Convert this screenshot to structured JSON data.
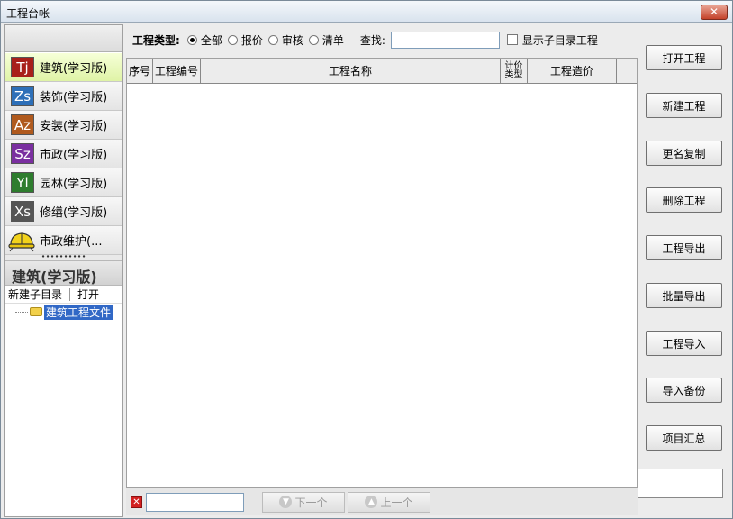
{
  "window": {
    "title": "工程台帐",
    "close_label": "✕"
  },
  "left": {
    "nav": [
      {
        "badge": "Tj",
        "label": "建筑(学习版)",
        "color": "#a8201a",
        "active": true
      },
      {
        "badge": "Zs",
        "label": "装饰(学习版)",
        "color": "#2d6fb8",
        "active": false
      },
      {
        "badge": "Az",
        "label": "安装(学习版)",
        "color": "#b05a1e",
        "active": false
      },
      {
        "badge": "Sz",
        "label": "市政(学习版)",
        "color": "#7a2fa0",
        "active": false
      },
      {
        "badge": "Yl",
        "label": "园林(学习版)",
        "color": "#2e7d2e",
        "active": false
      },
      {
        "badge": "Xs",
        "label": "修缮(学习版)",
        "color": "#555555",
        "active": false
      }
    ],
    "maintenance_label": "市政维护(...",
    "section_title": "建筑(学习版)",
    "tree_toolbar": {
      "new_dir": "新建子目录",
      "open": "打开"
    },
    "tree_item": "建筑工程文件"
  },
  "filter": {
    "label": "工程类型:",
    "options": [
      "全部",
      "报价",
      "审核",
      "清单"
    ],
    "selected": "全部",
    "search_label": "查找:",
    "search_value": "",
    "show_sub_label": "显示子目录工程"
  },
  "grid": {
    "columns": [
      "序号",
      "工程编号",
      "工程名称",
      "计价类型",
      "工程造价"
    ]
  },
  "bottom": {
    "next_label": "下一个",
    "prev_label": "上一个"
  },
  "actions": [
    "打开工程",
    "新建工程",
    "更名复制",
    "删除工程",
    "工程导出",
    "批量导出",
    "工程导入",
    "导入备份",
    "项目汇总"
  ]
}
